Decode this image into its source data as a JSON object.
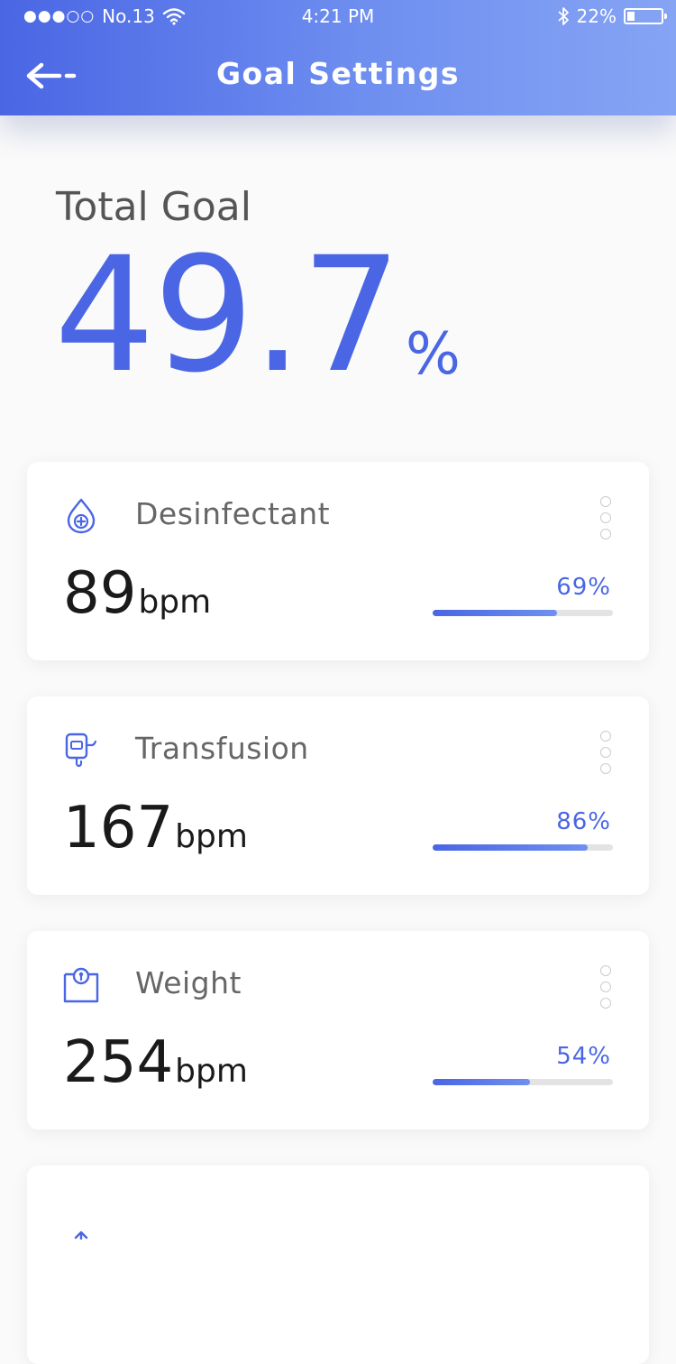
{
  "status_bar": {
    "signal": "●●●○○",
    "carrier": "No.13",
    "time": "4:21 PM",
    "battery_text": "22%",
    "battery_level": 0.22
  },
  "header": {
    "title": "Goal Settings",
    "back_icon": "back-arrow-icon"
  },
  "total": {
    "label": "Total Goal",
    "value": "49.7",
    "unit": "%"
  },
  "cards": [
    {
      "icon": "droplet-plus-icon",
      "name": "Desinfectant",
      "value": "89",
      "unit": "bpm",
      "percent_text": "69%",
      "progress": 0.69
    },
    {
      "icon": "transfusion-bag-icon",
      "name": "Transfusion",
      "value": "167",
      "unit": "bpm",
      "percent_text": "86%",
      "progress": 0.86
    },
    {
      "icon": "scale-icon",
      "name": "Weight",
      "value": "254",
      "unit": "bpm",
      "percent_text": "54%",
      "progress": 0.54
    }
  ],
  "colors": {
    "accent": "#4a66e4",
    "header_gradient_end": "#86a4f4",
    "track": "#e3e3e3"
  }
}
